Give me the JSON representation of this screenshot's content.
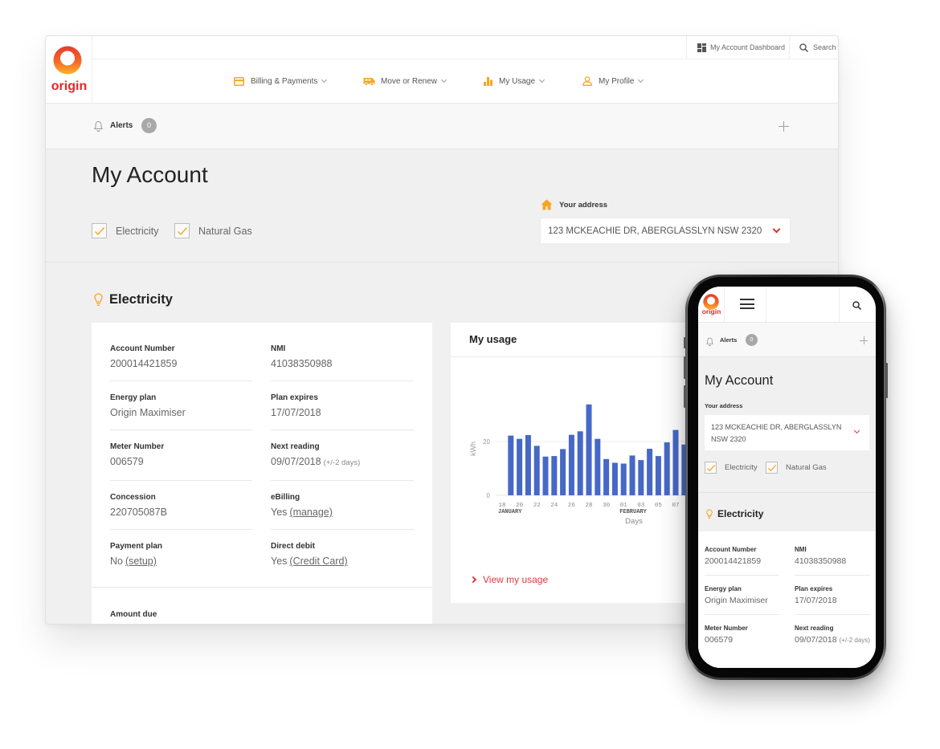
{
  "brand": {
    "name": "origin",
    "logo_icon": "origin-ring-logo"
  },
  "colors": {
    "accent": "#f5a623",
    "brand_red": "#e5262c",
    "link_red": "#e0393e",
    "chevron_red": "#e4312f",
    "bar_blue": "#4668c6"
  },
  "desktop": {
    "utility_nav": [
      {
        "label": "My Account Dashboard",
        "icon": "dashboard-grid-icon"
      },
      {
        "label": "Search",
        "icon": "search-icon"
      }
    ],
    "main_nav": [
      {
        "label": "Billing & Payments",
        "icon": "credit-card-icon"
      },
      {
        "label": "Move or Renew",
        "icon": "moving-van-icon"
      },
      {
        "label": "My Usage",
        "icon": "bar-chart-icon"
      },
      {
        "label": "My Profile",
        "icon": "user-icon"
      }
    ],
    "usage_card": {
      "title": "My usage",
      "link": "View my usage"
    },
    "amount_due_label": "Amount due"
  },
  "mobile": {
    "menu_icon": "hamburger-menu-icon",
    "search_icon": "search-icon"
  },
  "account": {
    "alerts": {
      "label": "Alerts",
      "count": "0"
    },
    "page_title": "My Account",
    "fuel_filters": [
      {
        "label": "Electricity",
        "checked": true
      },
      {
        "label": "Natural Gas",
        "checked": true
      }
    ],
    "address": {
      "label": "Your address",
      "value": "123 MCKEACHIE DR, ABERGLASSLYN NSW 2320"
    },
    "section_title": "Electricity",
    "fields": [
      {
        "label": "Account Number",
        "value": "200014421859"
      },
      {
        "label": "NMI",
        "value": "41038350988"
      },
      {
        "label": "Energy plan",
        "value": "Origin Maximiser"
      },
      {
        "label": "Plan expires",
        "value": "17/07/2018"
      },
      {
        "label": "Meter Number",
        "value": "006579"
      },
      {
        "label": "Next reading",
        "value": "09/07/2018",
        "note": "(+/-2 days)"
      },
      {
        "label": "Concession",
        "value": "220705087B"
      },
      {
        "label": "eBilling",
        "value": "Yes",
        "link": "(manage)"
      },
      {
        "label": "Payment plan",
        "value": "No",
        "link": "(setup)"
      },
      {
        "label": "Direct debit",
        "value": "Yes",
        "link": "(Credit Card)"
      }
    ]
  },
  "chart_data": {
    "type": "bar",
    "title": "My usage",
    "xlabel": "Days",
    "ylabel": "kWh",
    "ylim": [
      0,
      40
    ],
    "yticks": [
      0,
      20
    ],
    "grid": true,
    "legend": "none",
    "categories": [
      "18 Jan",
      "19 Jan",
      "20 Jan",
      "21 Jan",
      "22 Jan",
      "23 Jan",
      "24 Jan",
      "25 Jan",
      "26 Jan",
      "27 Jan",
      "28 Jan",
      "29 Jan",
      "30 Jan",
      "31 Jan",
      "01 Feb",
      "02 Feb",
      "03 Feb",
      "04 Feb",
      "05 Feb",
      "06 Feb",
      "07 Feb",
      "08 Feb"
    ],
    "values": [
      null,
      22.2,
      21.0,
      22.4,
      18.4,
      14.4,
      14.6,
      17.2,
      22.5,
      23.8,
      33.8,
      21.0,
      13.5,
      12.1,
      11.8,
      14.8,
      13.1,
      17.3,
      14.6,
      19.7,
      24.3,
      18.9
    ],
    "xtick_labels": [
      {
        "category": "18 Jan",
        "label": "18",
        "month": "JANUARY"
      },
      {
        "category": "20 Jan",
        "label": "20"
      },
      {
        "category": "22 Jan",
        "label": "22"
      },
      {
        "category": "24 Jan",
        "label": "24"
      },
      {
        "category": "26 Jan",
        "label": "26"
      },
      {
        "category": "28 Jan",
        "label": "28"
      },
      {
        "category": "30 Jan",
        "label": "30"
      },
      {
        "category": "01 Feb",
        "label": "01",
        "month": "FEBRUARY"
      },
      {
        "category": "03 Feb",
        "label": "03"
      },
      {
        "category": "05 Feb",
        "label": "05"
      },
      {
        "category": "07 Feb",
        "label": "07"
      }
    ]
  }
}
